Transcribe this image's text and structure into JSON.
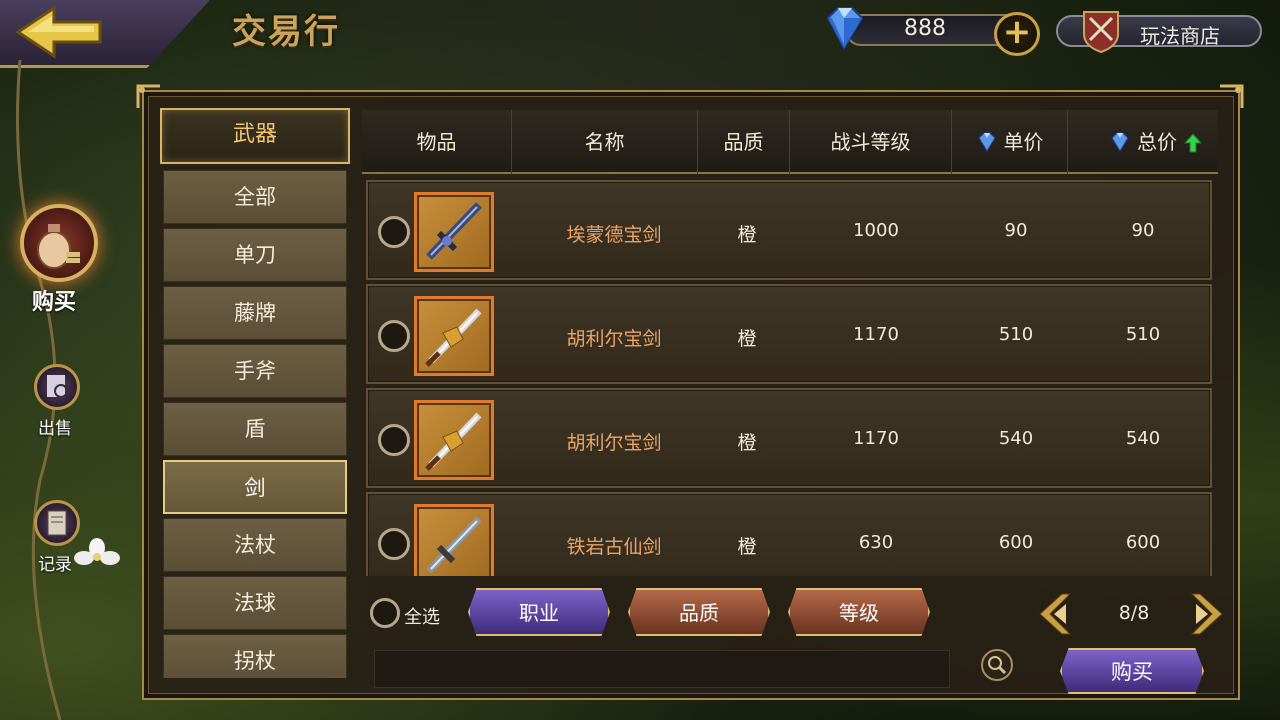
{
  "header": {
    "title": "交易行",
    "currency_amount": "888",
    "shop_label": "玩法商店"
  },
  "side_nav": {
    "buy_label": "购买",
    "sell_label": "出售",
    "record_label": "记录"
  },
  "categories": {
    "header": "武器",
    "items": [
      "全部",
      "单刀",
      "藤牌",
      "手斧",
      "盾",
      "剑",
      "法杖",
      "法球",
      "拐杖"
    ],
    "active": "剑"
  },
  "table": {
    "columns": [
      "物品",
      "名称",
      "品质",
      "战斗等级",
      "单价",
      "总价"
    ],
    "sort_column": "总价",
    "sort_direction": "ascending",
    "rows": [
      {
        "name": "埃蒙德宝剑",
        "quality": "橙",
        "level": "1000",
        "unit_price": "90",
        "total_price": "90",
        "icon": "dark-blue-sword-icon"
      },
      {
        "name": "胡利尔宝剑",
        "quality": "橙",
        "level": "1170",
        "unit_price": "510",
        "total_price": "510",
        "icon": "golden-dragon-sword-icon"
      },
      {
        "name": "胡利尔宝剑",
        "quality": "橙",
        "level": "1170",
        "unit_price": "540",
        "total_price": "540",
        "icon": "golden-dragon-sword-icon"
      },
      {
        "name": "铁岩古仙剑",
        "quality": "橙",
        "level": "630",
        "unit_price": "600",
        "total_price": "600",
        "icon": "iron-rock-sword-icon"
      }
    ]
  },
  "controls": {
    "select_all_label": "全选",
    "filter_job": "职业",
    "filter_quality": "品质",
    "filter_level": "等级",
    "page_indicator": "8/8",
    "buy_button": "购买"
  },
  "colors": {
    "gold_accent": "#d9b56a",
    "orange_item_name": "#e9a466",
    "purple_button": "#5a44a8",
    "brown_button": "#8a4a30"
  }
}
